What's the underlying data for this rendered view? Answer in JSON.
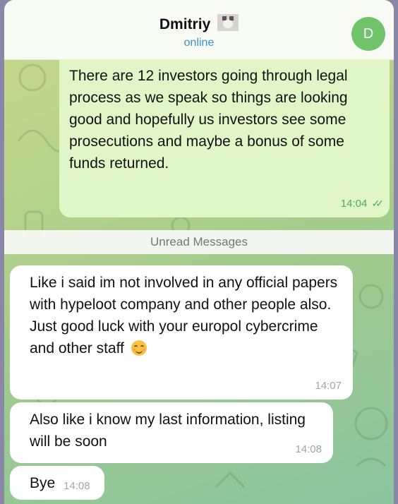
{
  "header": {
    "contact_name": "Dmitriy",
    "status": "online",
    "avatar_letter": "D"
  },
  "messages": {
    "outgoing": [
      {
        "text": "There are 12 investors going through legal process as we speak so things are looking good and hopefully us investors see some prosecutions and maybe a bonus of some funds returned.",
        "time": "14:04",
        "read_icon": "double-check-icon"
      }
    ],
    "divider_label": "Unread Messages",
    "incoming": [
      {
        "text": "Like i said im not involved in any official papers with hypeloot company and other people also. Just good luck with your europol cybercrime and other staff",
        "time": "14:07",
        "emoji": "smiling-face-icon"
      },
      {
        "text": "Also like i know my last information, listing will be soon",
        "time": "14:08"
      },
      {
        "text": "Bye",
        "time": "14:08"
      }
    ]
  },
  "colors": {
    "outgoing_bubble": "#e0f6c7",
    "incoming_bubble": "#ffffff",
    "status_blue": "#3d8fd0",
    "avatar_green": "#6fc36a"
  }
}
